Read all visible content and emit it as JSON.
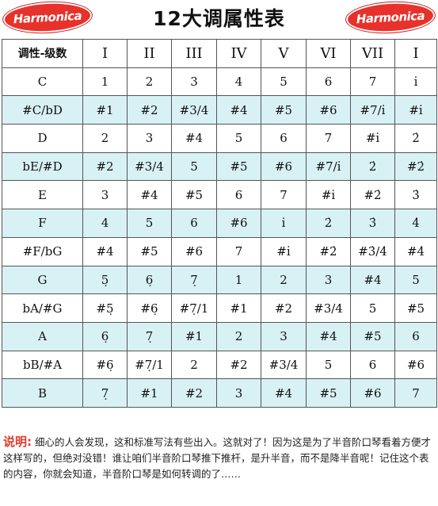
{
  "header": {
    "logo_left": "Harmonica",
    "logo_right": "Harmonica",
    "title": "12大调属性表"
  },
  "table": {
    "corner": "调性-级数",
    "columns": [
      "I",
      "II",
      "III",
      "IV",
      "V",
      "VI",
      "VII",
      "I"
    ],
    "rows": [
      {
        "key": "C",
        "cells": [
          "1",
          "2",
          "3",
          "4",
          "5",
          "6",
          "7",
          "i̇"
        ]
      },
      {
        "key": "#C/bD",
        "cells": [
          "#1",
          "#2",
          "#3/4",
          "#4",
          "#5",
          "#6",
          "#7/i̇",
          "#i̇"
        ]
      },
      {
        "key": "D",
        "cells": [
          "2",
          "3",
          "#4",
          "5",
          "6",
          "7",
          "#i̇",
          "2̇"
        ]
      },
      {
        "key": "bE/#D",
        "cells": [
          "#2",
          "#3/4",
          "5",
          "#5",
          "#6",
          "#7/i̇",
          "2̇",
          "#2̇"
        ]
      },
      {
        "key": "E",
        "cells": [
          "3",
          "#4",
          "#5",
          "6",
          "7",
          "#i̇",
          "#2̇",
          "3̇"
        ]
      },
      {
        "key": "F",
        "cells": [
          "4",
          "5",
          "6",
          "#6",
          "i̇",
          "2̇",
          "3̇",
          "4̇"
        ]
      },
      {
        "key": "#F/bG",
        "cells": [
          "#4",
          "#5",
          "#6",
          "7",
          "#i̇",
          "#2̇",
          "#3̇/4̇",
          "#4̇"
        ]
      },
      {
        "key": "G",
        "cells": [
          "5̣",
          "6̣",
          "7̣",
          "1",
          "2",
          "3",
          "#4",
          "5"
        ]
      },
      {
        "key": "bA/#G",
        "cells": [
          "#5̣",
          "#6̣",
          "#7̣/1",
          "#1",
          "#2",
          "#3/4",
          "5",
          "#5"
        ]
      },
      {
        "key": "A",
        "cells": [
          "6̣",
          "7̣",
          "#1",
          "2",
          "3",
          "#4",
          "#5",
          "6"
        ]
      },
      {
        "key": "bB/#A",
        "cells": [
          "#6̣",
          "#7̣/1",
          "2",
          "#2",
          "#3/4",
          "5",
          "6",
          "#6"
        ]
      },
      {
        "key": "B",
        "cells": [
          "7̣",
          "#1",
          "#2",
          "3",
          "#4",
          "#5",
          "#6",
          "7"
        ]
      }
    ]
  },
  "note": {
    "label": "说明:",
    "text": "细心的人会发现，这和标准写法有些出入。这就对了！因为这是为了半音阶口琴看着方便才这样写的，但绝对没错！谁让咱们半音阶口琴推下推杆，是升半音，而不是降半音呢！记住这个表的内容，你就会知道，半音阶口琴是如何转调的了……"
  },
  "colors": {
    "alt_row": "#d8f1f5",
    "logo_red": "#e8312a",
    "note_label": "#e03a2a"
  }
}
